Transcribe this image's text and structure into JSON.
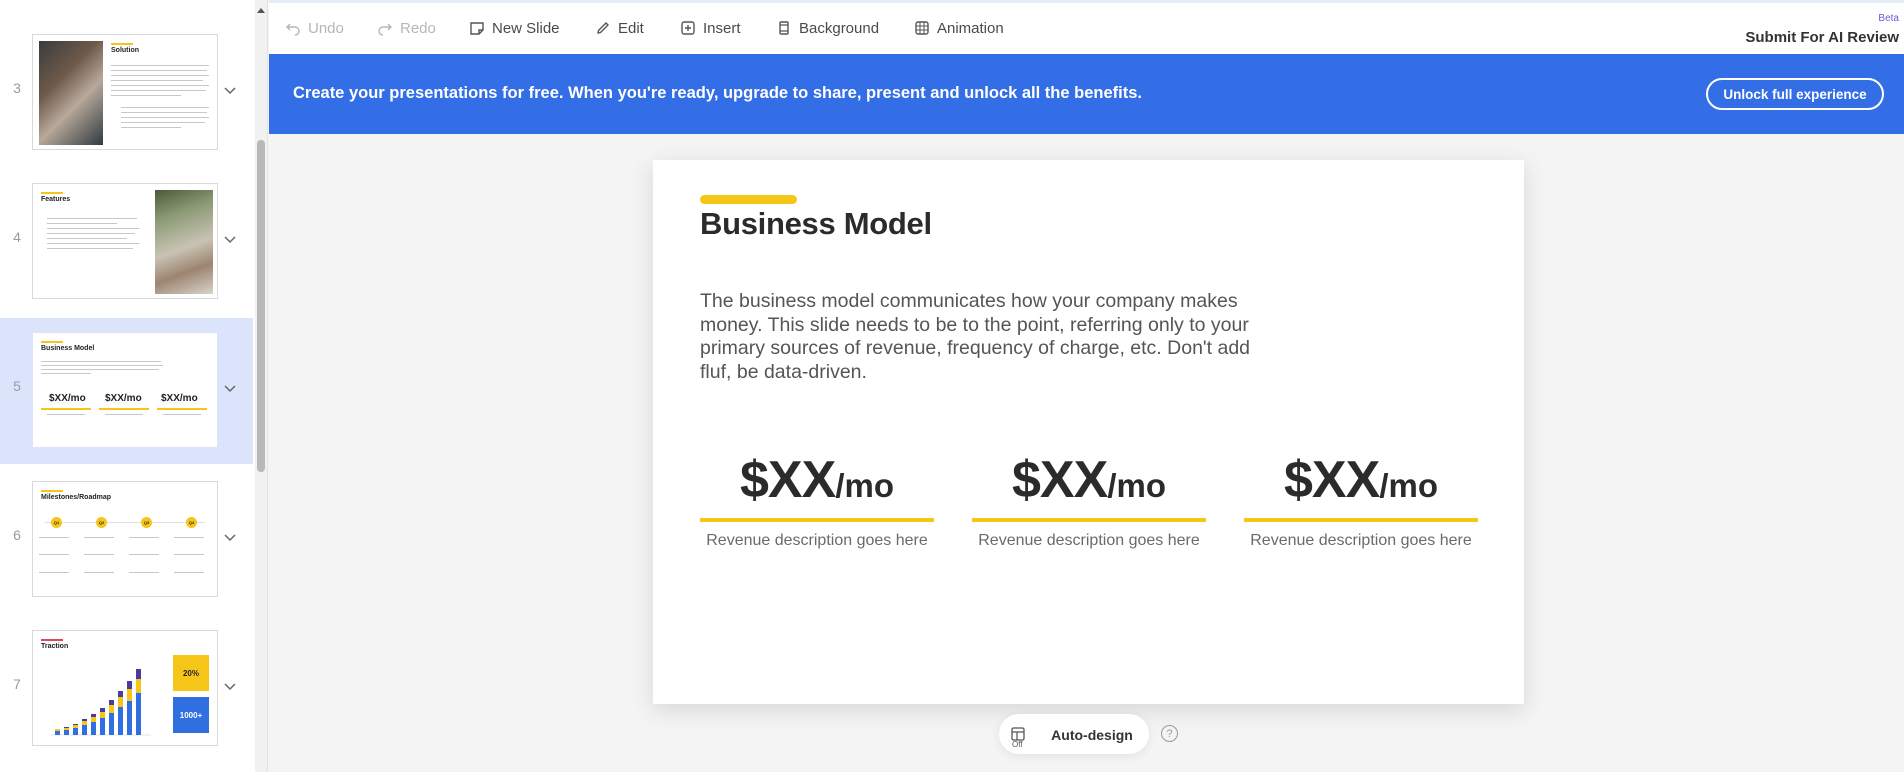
{
  "toolbar": {
    "undo": "Undo",
    "redo": "Redo",
    "new_slide": "New Slide",
    "edit": "Edit",
    "insert": "Insert",
    "background": "Background",
    "animation": "Animation",
    "beta": "Beta",
    "submit_review": "Submit For AI Review"
  },
  "banner": {
    "text": "Create your presentations for free. When you're ready, upgrade to share, present and unlock all the benefits.",
    "button": "Unlock full experience"
  },
  "sidebar": {
    "slides": [
      {
        "number": "3",
        "title": "Solution"
      },
      {
        "number": "4",
        "title": "Features"
      },
      {
        "number": "5",
        "title": "Business Model",
        "selected": true
      },
      {
        "number": "6",
        "title": "Milestones/Roadmap"
      },
      {
        "number": "7",
        "title": "Traction",
        "stat_percent": "20%",
        "stat_count": "1000+"
      }
    ],
    "mini_prices": [
      "$XX/mo",
      "$XX/mo",
      "$XX/mo"
    ],
    "roadmap_markers": [
      "Q1",
      "Q2",
      "Q3",
      "Q4"
    ]
  },
  "slide": {
    "title": "Business Model",
    "body": "The business model communicates how your company makes money. This slide needs to be to the point, referring only to your primary sources of revenue, frequency of charge, etc. Don't add fluf, be data-driven.",
    "prices": [
      {
        "amount": "$XX",
        "unit": "/mo",
        "description": "Revenue description goes here"
      },
      {
        "amount": "$XX",
        "unit": "/mo",
        "description": "Revenue description goes here"
      },
      {
        "amount": "$XX",
        "unit": "/mo",
        "description": "Revenue description goes here"
      }
    ]
  },
  "autodesign": {
    "toggle_state": "Off",
    "label": "Auto-design",
    "help": "?"
  },
  "colors": {
    "banner_blue": "#336ee6",
    "accent_yellow": "#f5c518",
    "selected_row": "#dbe4fb"
  }
}
